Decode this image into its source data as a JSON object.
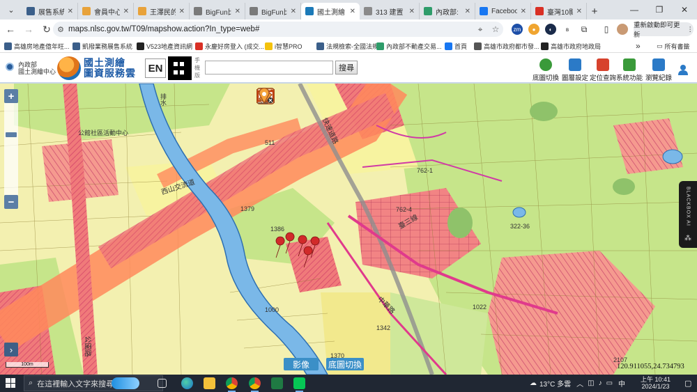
{
  "browser": {
    "tabs": [
      {
        "title": "展售系統",
        "favicon_color": "#3b5f8a",
        "active": false
      },
      {
        "title": "會員中心-",
        "favicon_color": "#e8a23a",
        "active": false
      },
      {
        "title": "王澤民的",
        "favicon_color": "#e8a23a",
        "active": false
      },
      {
        "title": "BigFun比",
        "favicon_color": "#7a7a7a",
        "active": false
      },
      {
        "title": "BigFun比",
        "favicon_color": "#7a7a7a",
        "active": false
      },
      {
        "title": "國土測繪",
        "favicon_color": "#1c7ab8",
        "active": true
      },
      {
        "title": "313 建置",
        "favicon_color": "#8a8a8a",
        "active": false
      },
      {
        "title": "內政部:",
        "favicon_color": "#2e9c6a",
        "active": false
      },
      {
        "title": "Facebook",
        "favicon_color": "#1877f2",
        "active": false
      },
      {
        "title": "臺灣10縣",
        "favicon_color": "#d93025",
        "active": false
      }
    ],
    "new_tab_label": "+",
    "url": "maps.nlsc.gov.tw/T09/mapshow.action?In_type=web#",
    "update_button_label": "重新啟動即可更新",
    "bookmarks": [
      {
        "label": "高雄房地產億年旺...",
        "color": "#3b5f8a"
      },
      {
        "label": "凱撥業務展售系統",
        "color": "#3b5f8a"
      },
      {
        "label": "V523地產資訊網",
        "color": "#222"
      },
      {
        "label": "永慶好房登入 (成交...",
        "color": "#d93025"
      },
      {
        "label": "i智慧PRO",
        "color": "#f4c20d"
      },
      {
        "label": "法規檢索-全國法規...",
        "color": "#3b5f8a"
      },
      {
        "label": "內政部不動產交易...",
        "color": "#2e9c6a"
      },
      {
        "label": "首頁",
        "color": "#1877f2"
      },
      {
        "label": "高雄市政府都市發...",
        "color": "#555"
      },
      {
        "label": "高雄市政府地政局",
        "color": "#222"
      }
    ],
    "bookmarks_more": "»",
    "all_bookmarks_label": "所有書籤"
  },
  "site": {
    "ministry_line1": "內政部",
    "ministry_line2": "國土測繪中心",
    "logo_line1": "國土測繪",
    "logo_line2": "圖資服務雲",
    "en_label": "EN",
    "qr_label": "手機版",
    "search_placeholder": "",
    "search_button": "搜尋",
    "tools": [
      {
        "label": "底圖切換",
        "icon": "globe-icon",
        "color": "#3a9a3a"
      },
      {
        "label": "圖層設定",
        "icon": "layers-icon",
        "color": "#2b7ac7"
      },
      {
        "label": "定位查詢",
        "icon": "locate-icon",
        "color": "#d7422d"
      },
      {
        "label": "系統功能",
        "icon": "calendar-icon",
        "color": "#3a9a3a"
      },
      {
        "label": "瀏覽紀錄",
        "icon": "history-icon",
        "color": "#2b7ac7"
      }
    ],
    "user_icon": "user-icon"
  },
  "map": {
    "zoom_in": "+",
    "zoom_out": "−",
    "expand_label": "›",
    "scale_label": "100m",
    "coordinates": "120.911055,24.734793",
    "basemap_buttons": [
      "影像",
      "底圖切換"
    ],
    "blackbox_label": "BLACKBOX AI",
    "road_labels": [
      "西山交流道",
      "公園路",
      "中華路",
      "臺三線",
      "快速道路"
    ],
    "place_labels": [
      "排水",
      "公館社區活動中心",
      "762-1",
      "762-4",
      "1022",
      "1342",
      "322-36",
      "1370",
      "1386",
      "1000",
      "2107",
      "1379",
      "511"
    ],
    "colors": {
      "residential": "#f06b6b",
      "agri": "#c6e58a",
      "highway": "#ff8a5c",
      "river": "#7ab8e8",
      "other": "#f7f3a0"
    }
  },
  "taskbar": {
    "search_placeholder": "在這裡輸入文字來搜尋",
    "weather": "13°C 多雲",
    "ime": "中",
    "time": "上午 10:41",
    "date": "2024/1/23"
  }
}
